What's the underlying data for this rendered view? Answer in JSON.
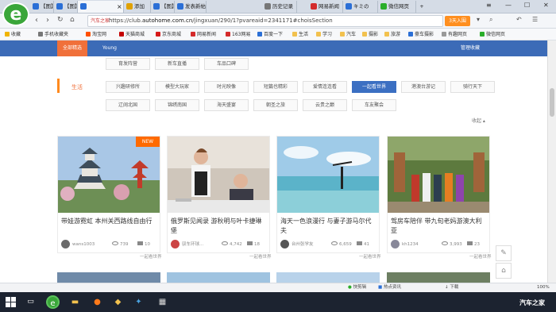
{
  "browser": {
    "tabs": [
      {
        "label": "【图】",
        "color": "#2b6fd6"
      },
      {
        "label": "【图】",
        "color": "#2b6fd6"
      },
      {
        "label": "添加",
        "color": "#e0a100"
      },
      {
        "label": "【图】",
        "color": "#2b6fd6"
      },
      {
        "label": "发表新帖",
        "color": "#2b6fd6"
      },
      {
        "label": "历史记录",
        "color": "#777777"
      },
      {
        "label": "网易新闻",
        "color": "#d42b2b"
      },
      {
        "label": "キミの",
        "color": "#2b6fd6"
      },
      {
        "label": "微信网页",
        "color": "#2aae2a"
      }
    ],
    "url_site": "汽车之家",
    "url_prefix": "https://club.",
    "url_domain": "autohome.com.cn",
    "url_path": "/jingxuan/290/1?pvareaid=2341171#choisSection",
    "mode_button": "3天入围",
    "bookmarks": [
      "收藏",
      "手机收藏夹",
      "淘宝网",
      "天猫商城",
      "京东商城",
      "网易新闻",
      "163网易",
      "百度一下",
      "生活",
      "学习",
      "汽车",
      "摄影",
      "旅游",
      "豪车摄影",
      "有趣网页",
      "微信网页"
    ]
  },
  "page": {
    "top_tabs": [
      "全部精选",
      "Young"
    ],
    "manage_link": "管理收藏",
    "row0": [
      "育发阵营",
      "新车直播",
      "车品口碑"
    ],
    "category_label": "生活",
    "row1": [
      "兴趣研修所",
      "模型大玩家",
      "时光映像",
      "短篇也精彩",
      "爱情连连看",
      "一起看世界",
      "港澳台游记",
      "骑行天下"
    ],
    "row2": [
      "辽阔北国",
      "锦绣南国",
      "海天盛宴",
      "朝圣之旅",
      "云贵之巅",
      "车友聚会"
    ],
    "selected_index": 5,
    "collapse": "收起 ▴",
    "new_badge": "NEW",
    "cards": [
      {
        "title": "带娃游霓虹 本州关西路线自由行",
        "user": "wans1003",
        "views": "739",
        "comments": "10",
        "from": "一起看世界"
      },
      {
        "title": "俄罗斯见闻录 游秋明与叶卡捷琳堡",
        "user": "驭车环球...",
        "views": "4,742",
        "comments": "18",
        "from": "一起看世界"
      },
      {
        "title": "海天一色浪漫行 与妻子游马尔代夫",
        "user": "台州张学友",
        "views": "6,659",
        "comments": "41",
        "from": "一起看世界"
      },
      {
        "title": "驾房车陪伴 带九旬老妈游澳大利亚",
        "user": "kh1234",
        "views": "3,993",
        "comments": "23",
        "from": "一起看世界"
      }
    ]
  },
  "status_bar": {
    "items": [
      "快剪辑",
      "热点资讯",
      "下载",
      "100%"
    ]
  },
  "taskbar": {
    "watermark": "汽车之家"
  }
}
